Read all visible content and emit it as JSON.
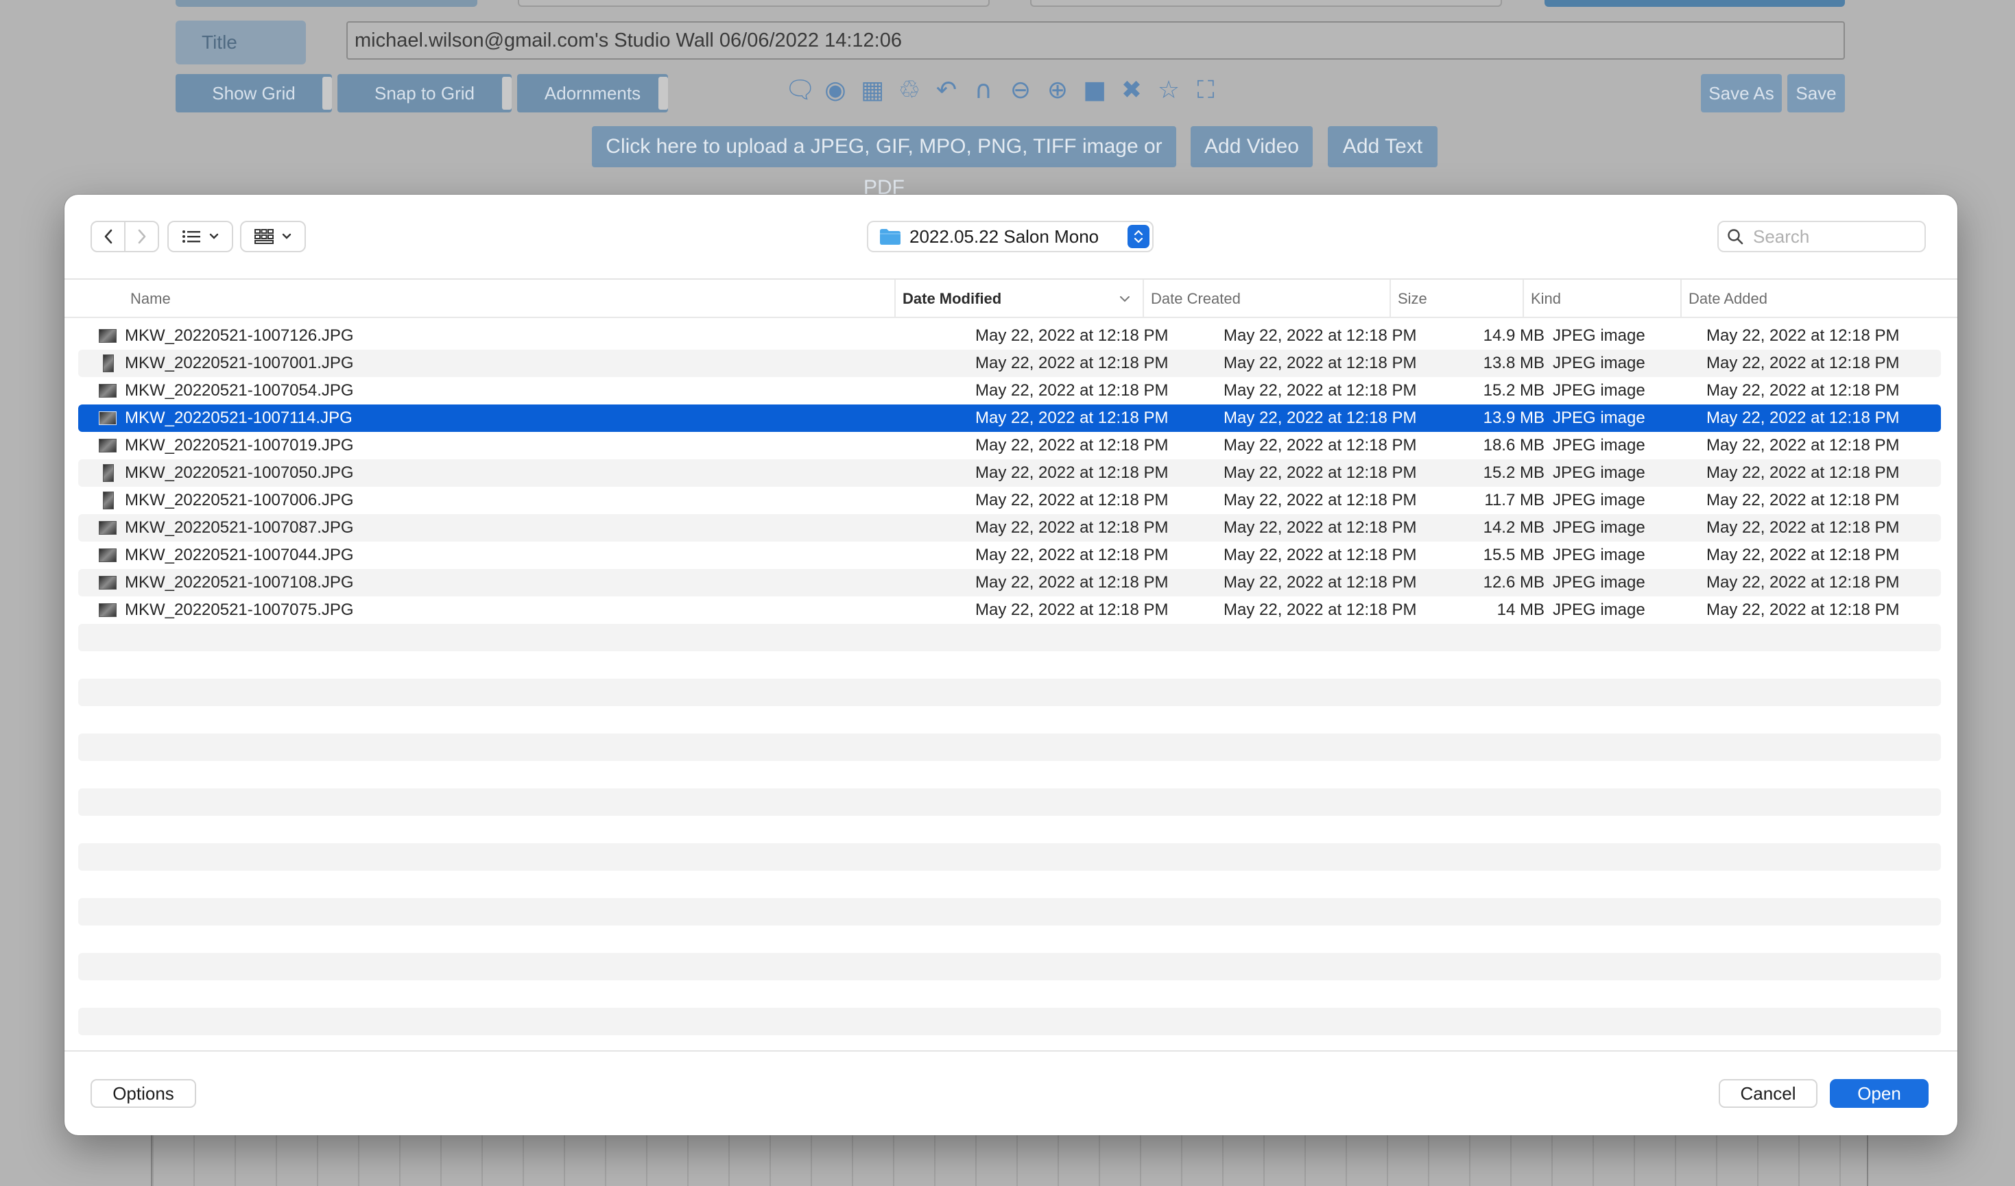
{
  "app": {
    "title_label": "Title",
    "title_value": "michael.wilson@gmail.com's Studio Wall 06/06/2022 14:12:06",
    "toggles": [
      "Show Grid",
      "Snap to Grid",
      "Adornments"
    ],
    "save_as_label": "Save As",
    "save_label": "Save",
    "upload_label": "Click here to upload a JPEG, GIF, MPO, PNG, TIFF image or PDF",
    "add_video_label": "Add Video",
    "add_text_label": "Add Text",
    "tool_icons": [
      "comment-icon",
      "camera-icon",
      "grid-icon",
      "trash-icon",
      "undo-icon",
      "arch-icon",
      "zoom-out-icon",
      "zoom-in-icon",
      "square-icon",
      "collapse-icon",
      "star-icon",
      "fullscreen-icon"
    ]
  },
  "dialog": {
    "location": "2022.05.22 Salon Mono",
    "search_placeholder": "Search",
    "columns": {
      "name": "Name",
      "date_modified": "Date Modified",
      "date_created": "Date Created",
      "size": "Size",
      "kind": "Kind",
      "date_added": "Date Added"
    },
    "sorted_column": "Date Modified",
    "files": [
      {
        "name": "MKW_20220521-1007126.JPG",
        "modified": "May 22, 2022 at 12:18 PM",
        "created": "May 22, 2022 at 12:18 PM",
        "size": "14.9 MB",
        "kind": "JPEG image",
        "added": "May 22, 2022 at 12:18 PM",
        "orientation": "landscape",
        "selected": false
      },
      {
        "name": "MKW_20220521-1007001.JPG",
        "modified": "May 22, 2022 at 12:18 PM",
        "created": "May 22, 2022 at 12:18 PM",
        "size": "13.8 MB",
        "kind": "JPEG image",
        "added": "May 22, 2022 at 12:18 PM",
        "orientation": "portrait",
        "selected": false
      },
      {
        "name": "MKW_20220521-1007054.JPG",
        "modified": "May 22, 2022 at 12:18 PM",
        "created": "May 22, 2022 at 12:18 PM",
        "size": "15.2 MB",
        "kind": "JPEG image",
        "added": "May 22, 2022 at 12:18 PM",
        "orientation": "landscape",
        "selected": false
      },
      {
        "name": "MKW_20220521-1007114.JPG",
        "modified": "May 22, 2022 at 12:18 PM",
        "created": "May 22, 2022 at 12:18 PM",
        "size": "13.9 MB",
        "kind": "JPEG image",
        "added": "May 22, 2022 at 12:18 PM",
        "orientation": "landscape",
        "selected": true
      },
      {
        "name": "MKW_20220521-1007019.JPG",
        "modified": "May 22, 2022 at 12:18 PM",
        "created": "May 22, 2022 at 12:18 PM",
        "size": "18.6 MB",
        "kind": "JPEG image",
        "added": "May 22, 2022 at 12:18 PM",
        "orientation": "landscape",
        "selected": false
      },
      {
        "name": "MKW_20220521-1007050.JPG",
        "modified": "May 22, 2022 at 12:18 PM",
        "created": "May 22, 2022 at 12:18 PM",
        "size": "15.2 MB",
        "kind": "JPEG image",
        "added": "May 22, 2022 at 12:18 PM",
        "orientation": "portrait",
        "selected": false
      },
      {
        "name": "MKW_20220521-1007006.JPG",
        "modified": "May 22, 2022 at 12:18 PM",
        "created": "May 22, 2022 at 12:18 PM",
        "size": "11.7 MB",
        "kind": "JPEG image",
        "added": "May 22, 2022 at 12:18 PM",
        "orientation": "portrait",
        "selected": false
      },
      {
        "name": "MKW_20220521-1007087.JPG",
        "modified": "May 22, 2022 at 12:18 PM",
        "created": "May 22, 2022 at 12:18 PM",
        "size": "14.2 MB",
        "kind": "JPEG image",
        "added": "May 22, 2022 at 12:18 PM",
        "orientation": "landscape",
        "selected": false
      },
      {
        "name": "MKW_20220521-1007044.JPG",
        "modified": "May 22, 2022 at 12:18 PM",
        "created": "May 22, 2022 at 12:18 PM",
        "size": "15.5 MB",
        "kind": "JPEG image",
        "added": "May 22, 2022 at 12:18 PM",
        "orientation": "landscape",
        "selected": false
      },
      {
        "name": "MKW_20220521-1007108.JPG",
        "modified": "May 22, 2022 at 12:18 PM",
        "created": "May 22, 2022 at 12:18 PM",
        "size": "12.6 MB",
        "kind": "JPEG image",
        "added": "May 22, 2022 at 12:18 PM",
        "orientation": "landscape",
        "selected": false
      },
      {
        "name": "MKW_20220521-1007075.JPG",
        "modified": "May 22, 2022 at 12:18 PM",
        "created": "May 22, 2022 at 12:18 PM",
        "size": "14 MB",
        "kind": "JPEG image",
        "added": "May 22, 2022 at 12:18 PM",
        "orientation": "landscape",
        "selected": false
      }
    ],
    "options_label": "Options",
    "cancel_label": "Cancel",
    "open_label": "Open"
  },
  "colors": {
    "accent": "#1a6fe0",
    "selection": "#0a5fd6",
    "backdrop": "#b4b4b4"
  }
}
